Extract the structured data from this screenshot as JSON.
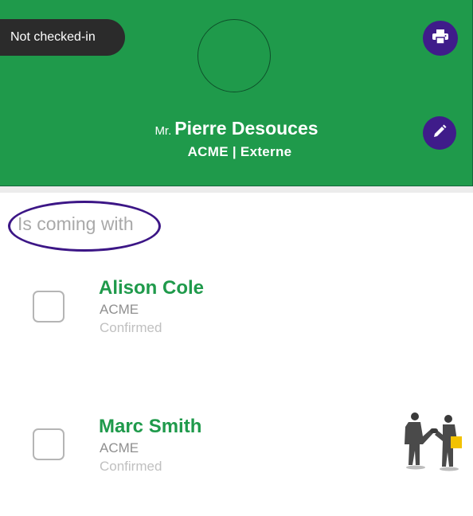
{
  "header": {
    "status_label": "Not checked-in",
    "print_icon": "printer-icon",
    "edit_icon": "pencil-icon",
    "title": "Mr.",
    "name": "Pierre Desouces",
    "organization_line": "ACME | Externe",
    "background_color": "#1f9a4b",
    "button_color": "#3f1c8a"
  },
  "section": {
    "title": "Is coming with"
  },
  "companions": [
    {
      "name": "Alison Cole",
      "organization": "ACME",
      "status": "Confirmed",
      "checked": false
    },
    {
      "name": "Marc Smith",
      "organization": "ACME",
      "status": "Confirmed",
      "checked": false,
      "illustration": "handshake-illustration"
    }
  ]
}
